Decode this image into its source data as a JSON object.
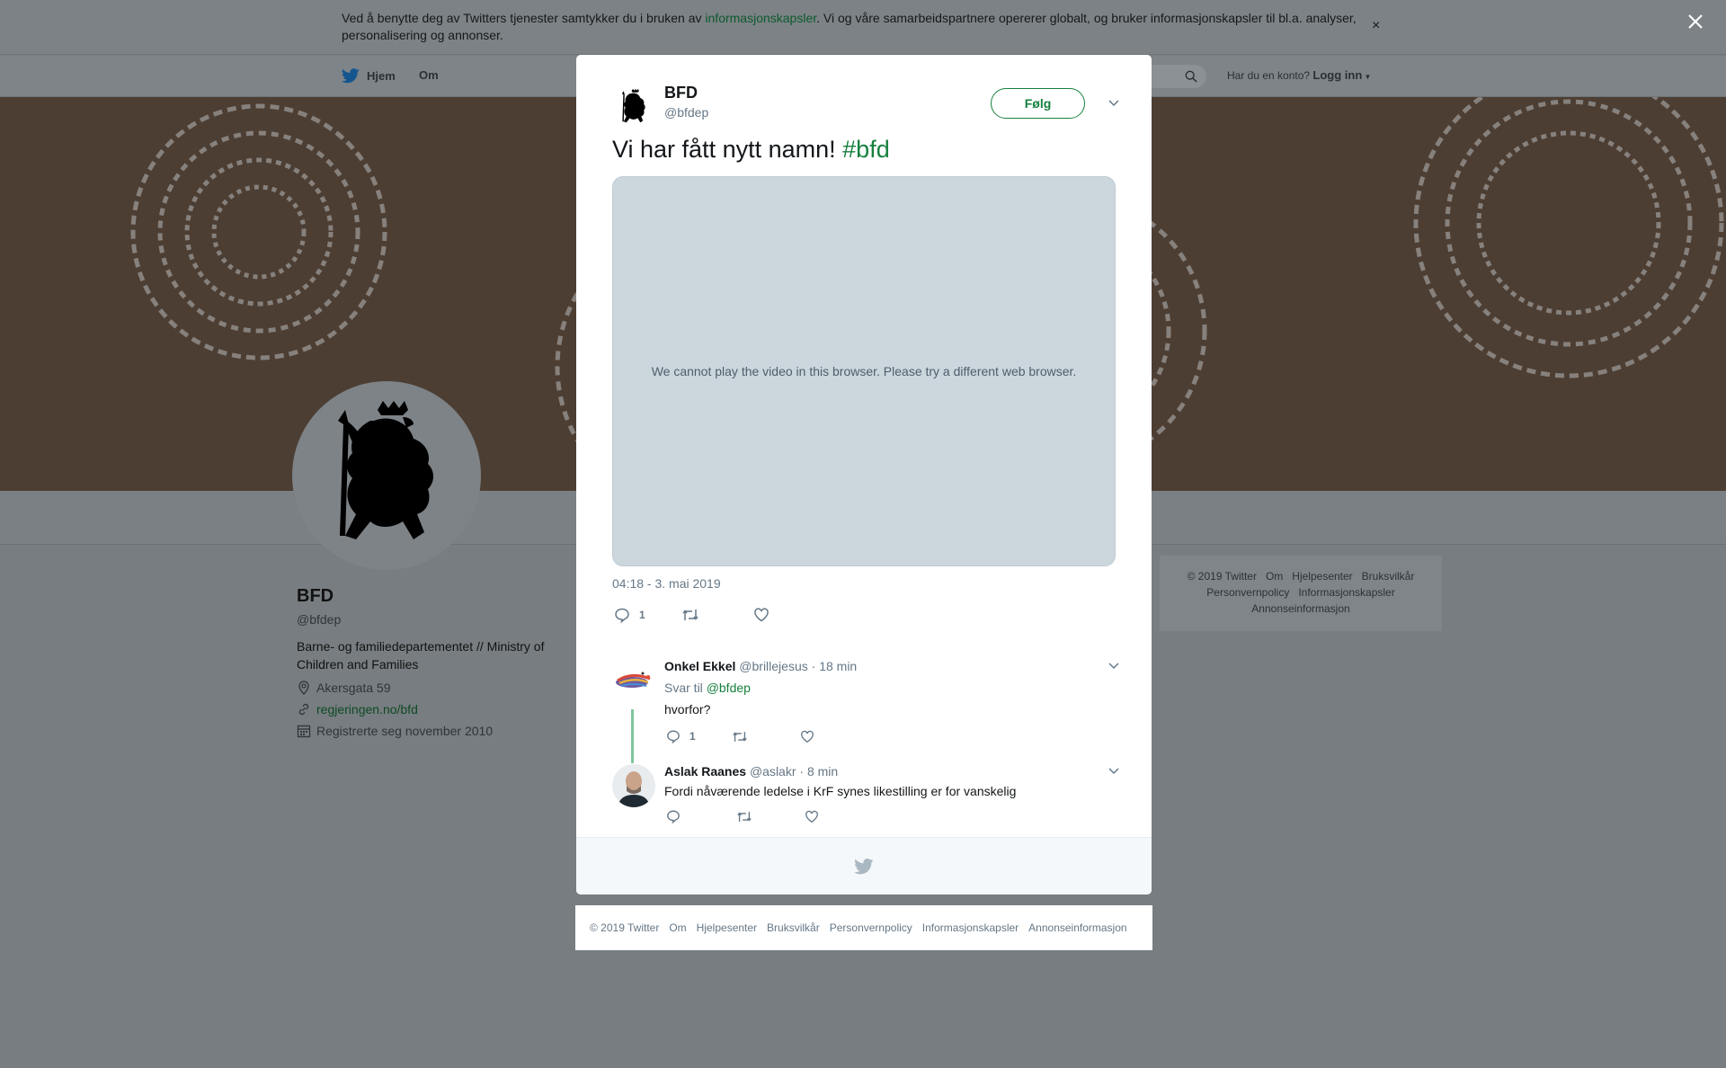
{
  "cookie_banner": {
    "text_before": "Ved å benytte deg av Twitters tjenester samtykker du i bruken av ",
    "link": "informasjonskapsler",
    "text_after": ". Vi og våre samarbeidspartnere opererer globalt, og bruker informasjonskapsler til bl.a. analyser, personalisering og annonser.",
    "close": "×"
  },
  "nav": {
    "home": "Hjem",
    "about": "Om",
    "login_prompt": "Har du en konto?",
    "login": "Logg inn"
  },
  "profile": {
    "name": "BFD",
    "handle": "@bfdep",
    "bio": "Barne- og familiedepartementet // Ministry of Children and Families",
    "location": "Akersgata 59",
    "website": "regjeringen.no/bfd",
    "joined": "Registrerte seg november 2010"
  },
  "side_footer": {
    "items": [
      "© 2019 Twitter",
      "Om",
      "Hjelpesenter",
      "Bruksvilkår",
      "Personvernpolicy",
      "Informasjonskapsler",
      "Annonseinformasjon"
    ]
  },
  "tweet": {
    "name": "BFD",
    "handle": "@bfdep",
    "follow": "Følg",
    "text": "Vi har fått nytt namn!",
    "hashtag": "#bfd",
    "video_message": "We cannot play the video in this browser. Please try a different web browser.",
    "timestamp": "04:18 - 3. mai 2019",
    "reply_count": "1"
  },
  "replies": [
    {
      "name": "Onkel Ekkel",
      "handle": "@brillejesus",
      "time": "· 18 min",
      "reply_to_label": "Svar til",
      "reply_to": "@bfdep",
      "text": "hvorfor?",
      "reply_count": "1"
    },
    {
      "name": "Aslak Raanes",
      "handle": "@aslakr",
      "time": "· 8 min",
      "text": "Fordi nåværende ledelse i KrF synes likestilling er for vanskelig"
    }
  ],
  "bottom_footer": {
    "items": [
      "© 2019 Twitter",
      "Om",
      "Hjelpesenter",
      "Bruksvilkår",
      "Personvernpolicy",
      "Informasjonskapsler",
      "Annonseinformasjon"
    ]
  },
  "colors": {
    "accent": "#17803f",
    "overlay": "#777d80",
    "video_bg": "#ccd6dd"
  }
}
